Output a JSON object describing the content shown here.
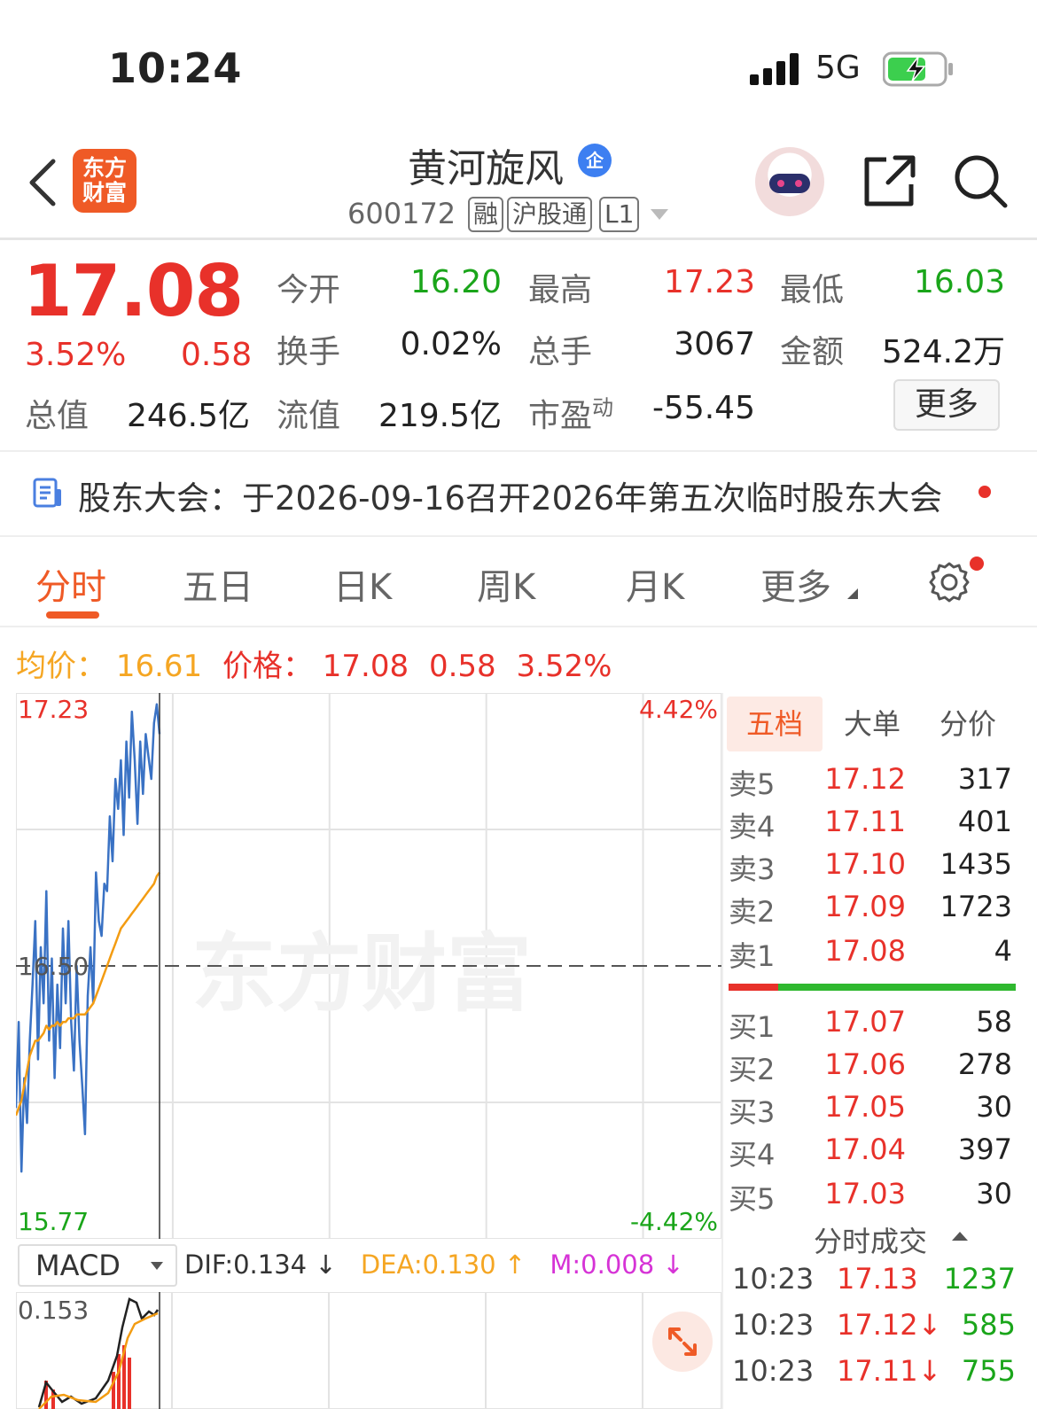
{
  "status_bar": {
    "time": "10:24",
    "network": "5G"
  },
  "header": {
    "logo_text": "东方\n财富",
    "stock_name": "黄河旋风",
    "corp_badge": "企",
    "stock_code": "600172",
    "tags": [
      "融",
      "沪股通",
      "L1"
    ]
  },
  "quote": {
    "price": "17.08",
    "change_pct": "3.52%",
    "change": "0.58",
    "fields": [
      {
        "label": "今开",
        "value": "16.20",
        "color": "green"
      },
      {
        "label": "最高",
        "value": "17.23",
        "color": "red"
      },
      {
        "label": "最低",
        "value": "16.03",
        "color": "green"
      },
      {
        "label": "换手",
        "value": "0.02%",
        "color": "black"
      },
      {
        "label": "总手",
        "value": "3067",
        "color": "black"
      },
      {
        "label": "金额",
        "value": "524.2万",
        "color": "black"
      },
      {
        "label": "总值",
        "value": "246.5亿",
        "color": "black"
      },
      {
        "label": "流值",
        "value": "219.5亿",
        "color": "black"
      },
      {
        "label": "市盈",
        "sup": "动",
        "value": "-55.45",
        "color": "black"
      }
    ],
    "more_label": "更多"
  },
  "notice": {
    "text": "股东大会：于2026-09-16召开2026年第五次临时股东大会"
  },
  "tabs": [
    "分时",
    "五日",
    "日K",
    "周K",
    "月K",
    "更多"
  ],
  "avg_line": {
    "avg_label": "均价：",
    "avg_value": "16.61",
    "price_label": "价格：",
    "price_value": "17.08",
    "change": "0.58",
    "change_pct": "3.52%"
  },
  "chart_data": {
    "type": "line",
    "y_left_labels": [
      "17.23",
      "16.50",
      "15.77"
    ],
    "y_right_labels": [
      "4.42%",
      "-4.42%"
    ],
    "ylim": [
      15.77,
      17.23
    ],
    "baseline": 16.5,
    "watermark": "东方财富",
    "series": [
      {
        "color": "#3a72c4",
        "values": [
          16.12,
          16.35,
          15.95,
          16.2,
          16.08,
          16.3,
          16.45,
          16.62,
          16.25,
          16.55,
          16.4,
          16.7,
          16.3,
          16.52,
          16.2,
          16.45,
          16.28,
          16.6,
          16.4,
          16.62,
          16.35,
          16.22,
          16.5,
          16.3,
          16.18,
          16.05,
          16.42,
          16.55,
          16.4,
          16.75,
          16.62,
          16.58,
          16.72,
          16.7,
          16.9,
          16.78,
          17.0,
          16.92,
          17.05,
          16.85,
          17.1,
          16.95,
          17.18,
          17.05,
          16.88,
          17.1,
          16.96,
          17.12,
          17.06,
          17.0,
          17.15,
          17.2,
          17.12
        ]
      },
      {
        "color": "#f39c12",
        "values": [
          16.1,
          16.12,
          16.14,
          16.18,
          16.22,
          16.26,
          16.28,
          16.3,
          16.3,
          16.31,
          16.32,
          16.34,
          16.33,
          16.34,
          16.34,
          16.35,
          16.34,
          16.35,
          16.35,
          16.36,
          16.36,
          16.36,
          16.37,
          16.37,
          16.37,
          16.37,
          16.38,
          16.39,
          16.4,
          16.42,
          16.44,
          16.46,
          16.48,
          16.5,
          16.52,
          16.54,
          16.56,
          16.58,
          16.6,
          16.61,
          16.62,
          16.63,
          16.64,
          16.65,
          16.66,
          16.67,
          16.68,
          16.69,
          16.7,
          16.71,
          16.72,
          16.74,
          16.75
        ]
      }
    ]
  },
  "macd": {
    "select_label": "MACD",
    "dif": "DIF:0.134 ↓",
    "dea": "DEA:0.130 ↑",
    "m": "M:0.008 ↓",
    "top_label": "0.153"
  },
  "order_book": {
    "tabs": [
      "五档",
      "大单",
      "分价"
    ],
    "asks": [
      {
        "label": "卖5",
        "price": "17.12",
        "vol": "317"
      },
      {
        "label": "卖4",
        "price": "17.11",
        "vol": "401"
      },
      {
        "label": "卖3",
        "price": "17.10",
        "vol": "1435"
      },
      {
        "label": "卖2",
        "price": "17.09",
        "vol": "1723"
      },
      {
        "label": "卖1",
        "price": "17.08",
        "vol": "4"
      }
    ],
    "bids": [
      {
        "label": "买1",
        "price": "17.07",
        "vol": "58"
      },
      {
        "label": "买2",
        "price": "17.06",
        "vol": "278"
      },
      {
        "label": "买3",
        "price": "17.05",
        "vol": "30"
      },
      {
        "label": "买4",
        "price": "17.04",
        "vol": "397"
      },
      {
        "label": "买5",
        "price": "17.03",
        "vol": "30"
      }
    ],
    "trades_title": "分时成交",
    "trades": [
      {
        "time": "10:23",
        "price": "17.13",
        "vol": "1237",
        "vol_color": "green"
      },
      {
        "time": "10:23",
        "price": "17.12↓",
        "vol": "585",
        "vol_color": "green"
      },
      {
        "time": "10:23",
        "price": "17.11↓",
        "vol": "755",
        "vol_color": "green"
      }
    ]
  }
}
